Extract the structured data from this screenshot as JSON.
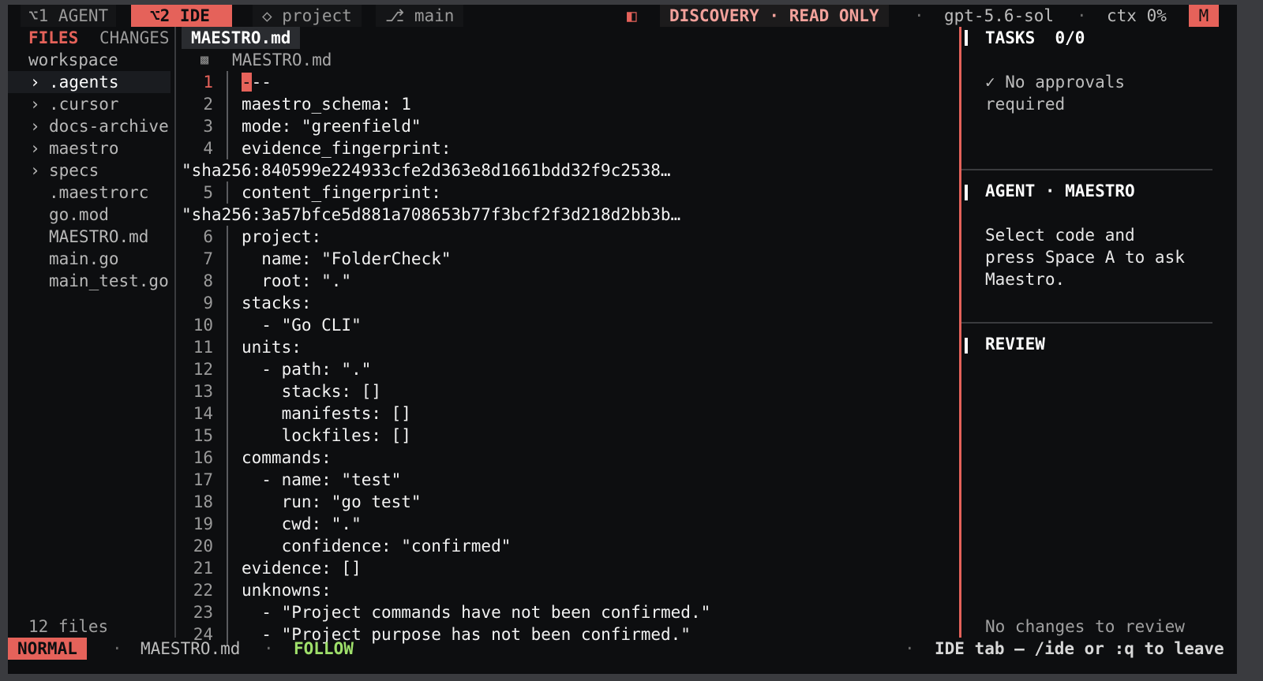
{
  "topbar": {
    "tabs": [
      {
        "label": "⌥1 AGENT"
      },
      {
        "label": "⌥2 IDE"
      }
    ],
    "project_label": "◇ project",
    "branch_label": "⎇ main",
    "mode_icon": "◧",
    "mode_label": "DISCOVERY · READ ONLY",
    "sep": "·",
    "model": "gpt-5.6-sol",
    "ctx": "ctx 0%",
    "m_badge": "M"
  },
  "sidebar": {
    "tab_files": "FILES",
    "tab_changes": "CHANGES",
    "root": "workspace",
    "items": [
      {
        "chev": "›",
        "label": ".agents"
      },
      {
        "chev": "›",
        "label": ".cursor"
      },
      {
        "chev": "›",
        "label": "docs-archive"
      },
      {
        "chev": "›",
        "label": "maestro"
      },
      {
        "chev": "›",
        "label": "specs"
      },
      {
        "chev": "",
        "label": ".maestrorc"
      },
      {
        "chev": "",
        "label": "go.mod"
      },
      {
        "chev": "",
        "label": "MAESTRO.md"
      },
      {
        "chev": "",
        "label": "main.go"
      },
      {
        "chev": "",
        "label": "main_test.go"
      }
    ],
    "count": "12 files"
  },
  "editor": {
    "tab": "MAESTRO.md",
    "file_icon": "▩",
    "file_path": "MAESTRO.md",
    "lines": [
      {
        "n": "1",
        "text": "---"
      },
      {
        "n": "2",
        "text": "maestro_schema: 1"
      },
      {
        "n": "3",
        "text": "mode: \"greenfield\""
      },
      {
        "n": "4",
        "text": "evidence_fingerprint:"
      },
      {
        "n": "",
        "text": "\"sha256:840599e224933cfe2d363e8d1661bdd32f9c2538…"
      },
      {
        "n": "5",
        "text": "content_fingerprint:"
      },
      {
        "n": "",
        "text": "\"sha256:3a57bfce5d881a708653b77f3bcf2f3d218d2bb3b…"
      },
      {
        "n": "6",
        "text": "project:"
      },
      {
        "n": "7",
        "text": "  name: \"FolderCheck\""
      },
      {
        "n": "8",
        "text": "  root: \".\""
      },
      {
        "n": "9",
        "text": "stacks:"
      },
      {
        "n": "10",
        "text": "  - \"Go CLI\""
      },
      {
        "n": "11",
        "text": "units:"
      },
      {
        "n": "12",
        "text": "  - path: \".\""
      },
      {
        "n": "13",
        "text": "    stacks: []"
      },
      {
        "n": "14",
        "text": "    manifests: []"
      },
      {
        "n": "15",
        "text": "    lockfiles: []"
      },
      {
        "n": "16",
        "text": "commands:"
      },
      {
        "n": "17",
        "text": "  - name: \"test\""
      },
      {
        "n": "18",
        "text": "    run: \"go test\""
      },
      {
        "n": "19",
        "text": "    cwd: \".\""
      },
      {
        "n": "20",
        "text": "    confidence: \"confirmed\""
      },
      {
        "n": "21",
        "text": "evidence: []"
      },
      {
        "n": "22",
        "text": "unknowns:"
      },
      {
        "n": "23",
        "text": "  - \"Project commands have not been confirmed.\""
      },
      {
        "n": "24",
        "text": "  - \"Project purpose has not been confirmed.\""
      }
    ]
  },
  "panel": {
    "tasks_title": "TASKS  0/0",
    "tasks_line1": "✓ No approvals",
    "tasks_line2": "required",
    "agent_title": "AGENT · MAESTRO",
    "agent_line1": "Select code and",
    "agent_line2": "press Space A to ask",
    "agent_line3": "Maestro.",
    "review_title": "REVIEW",
    "review_empty": "No changes to review"
  },
  "status": {
    "mode": "NORMAL",
    "sep": "·",
    "file": "MAESTRO.md",
    "follow": "FOLLOW",
    "hint": "IDE tab — /ide or :q to leave"
  },
  "colors": {
    "accent": "#e5625a",
    "follow": "#9fe06b",
    "background": "#0d0e10"
  }
}
